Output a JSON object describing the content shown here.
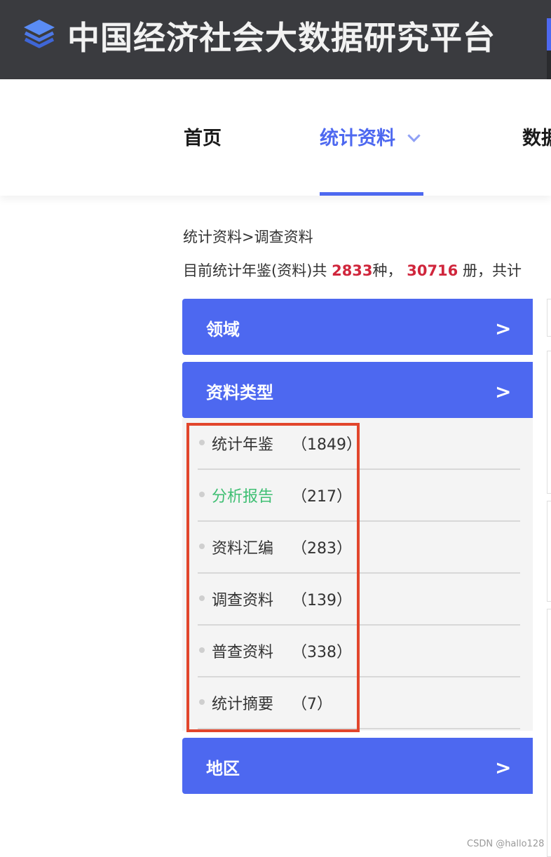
{
  "header": {
    "site_title": "中国经济社会大数据研究平台",
    "logo_icon": "layers-icon"
  },
  "nav": {
    "items": [
      {
        "label": "首页"
      },
      {
        "label": "统计资料"
      },
      {
        "label": "数据"
      }
    ],
    "active_index": 1,
    "dropdown_icon": "chevron-down-icon"
  },
  "breadcrumb": "统计资料>调查资料",
  "summary": {
    "prefix": "目前统计年鉴(资料)共",
    "kinds_count": "2833",
    "kinds_unit": "种，",
    "volumes_count": "30716",
    "volumes_unit": "册，共计"
  },
  "filters": {
    "domain": {
      "title": "领域",
      "arrow": ">"
    },
    "type": {
      "title": "资料类型",
      "arrow": ">",
      "items": [
        {
          "name": "统计年鉴",
          "count": "（1849）"
        },
        {
          "name": "分析报告",
          "count": "（217）"
        },
        {
          "name": "资料汇编",
          "count": "（283）"
        },
        {
          "name": "调查资料",
          "count": "（139）"
        },
        {
          "name": "普查资料",
          "count": "（338）"
        },
        {
          "name": "统计摘要",
          "count": "（7）"
        }
      ],
      "hovered_index": 1
    },
    "region": {
      "title": "地区",
      "arrow": ">"
    }
  },
  "colors": {
    "accent": "#4d68f0",
    "header_bg": "#3a3b3f",
    "highlight_red": "#d0263c",
    "hover_green": "#3fbf73",
    "annotation_box": "#e2462c"
  },
  "watermark": "CSDN @hallo128"
}
